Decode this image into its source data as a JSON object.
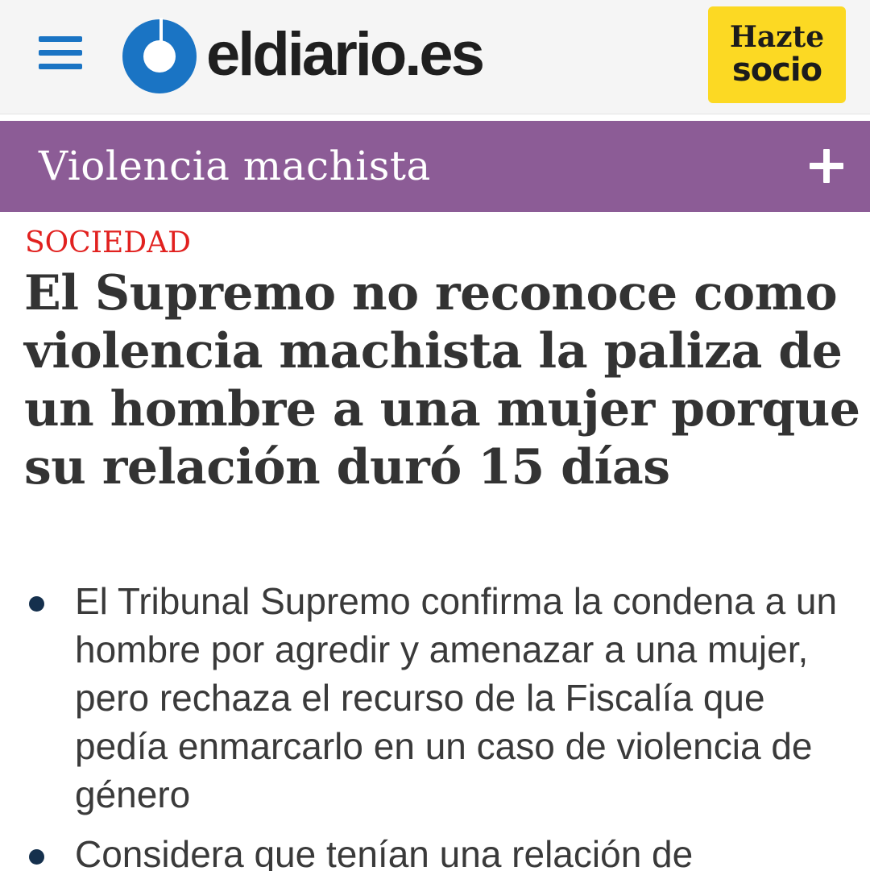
{
  "header": {
    "menu_icon": "hamburger-menu-icon",
    "logo_text": "eldiario.es",
    "logo_icon": "eldiario-logo-mark",
    "brand_color": "#1a74c4",
    "socio_button": {
      "line1": "Hazte",
      "line2": "socio",
      "color": "#fcd923"
    }
  },
  "topic_bar": {
    "title": "Violencia machista",
    "expand_icon": "plus-icon",
    "color": "#8c5c96"
  },
  "article": {
    "section": "SOCIEDAD",
    "section_color": "#e1211f",
    "headline": "El Supremo no reconoce como violencia machista la paliza de un hombre a una mujer porque su relación duró 15 días",
    "summary": [
      "El Tribunal Supremo confirma la condena a un hombre por agredir y amenazar a una mujer, pero rechaza el recurso de la Fiscalía que pedía enmarcarlo en un caso de violencia de género",
      "Considera que tenían una relación de"
    ]
  }
}
